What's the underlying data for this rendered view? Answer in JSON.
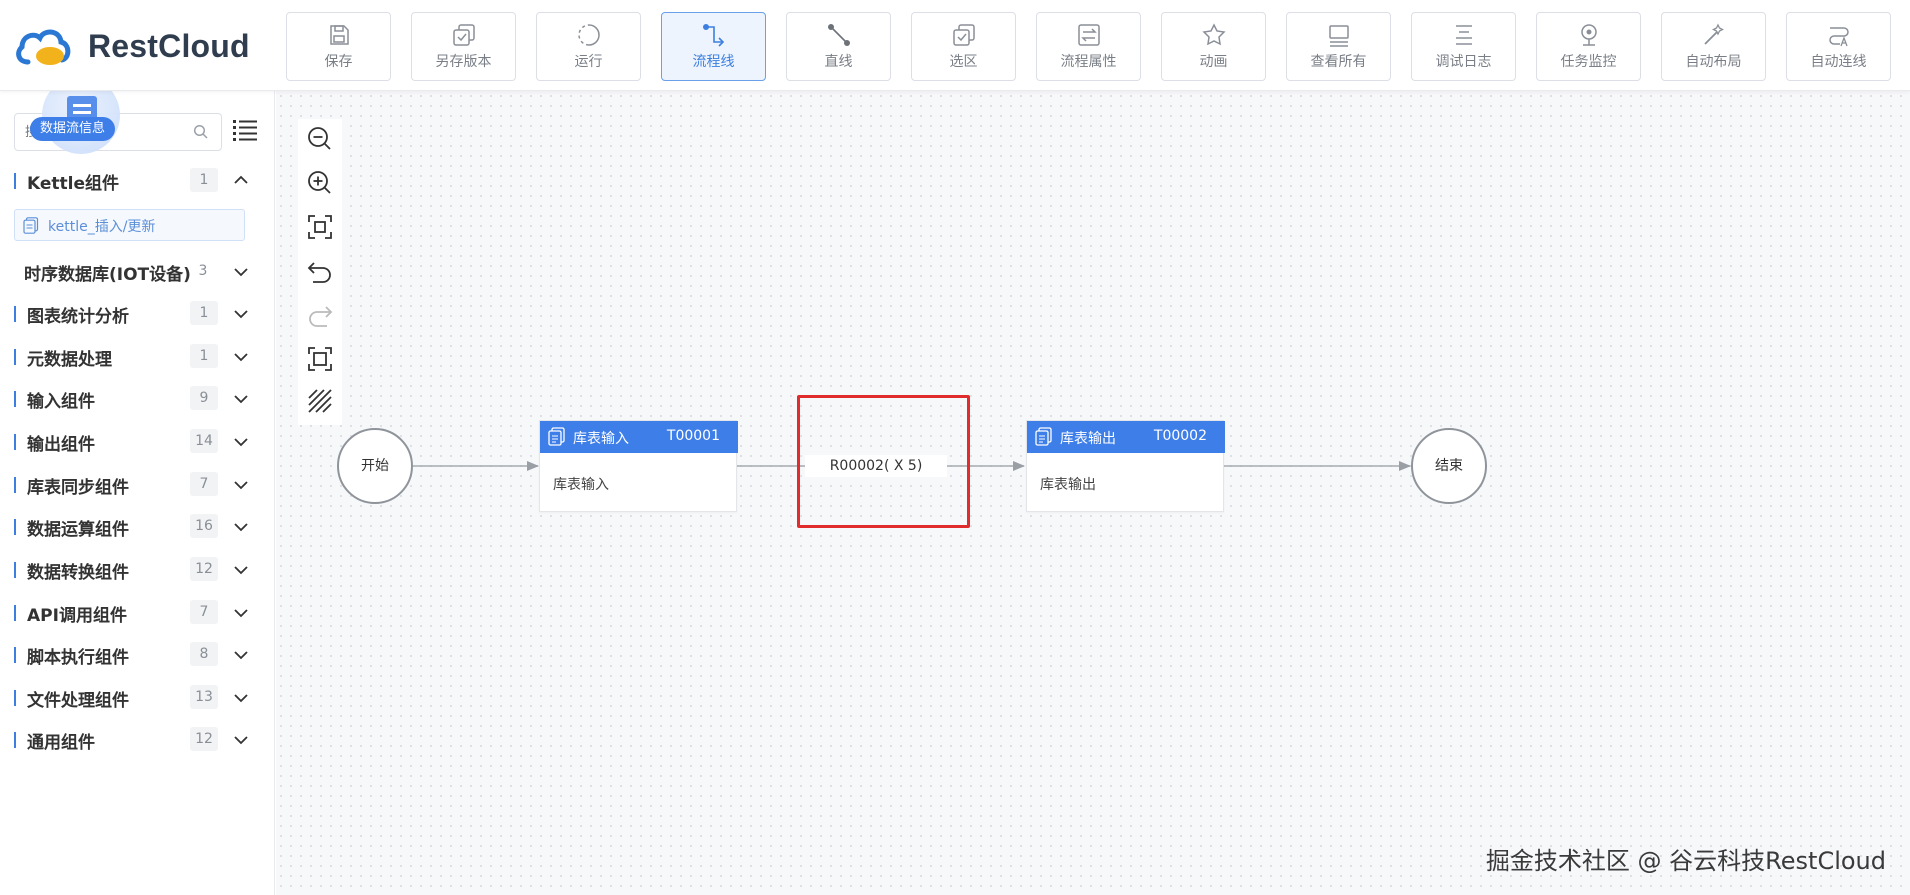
{
  "app": {
    "logo_text": "RestCloud"
  },
  "toolbar": [
    {
      "label": "保存",
      "icon": "save-icon"
    },
    {
      "label": "另存版本",
      "icon": "save-as-icon"
    },
    {
      "label": "运行",
      "icon": "run-icon"
    },
    {
      "label": "流程线",
      "icon": "flow-line-icon",
      "active": true
    },
    {
      "label": "直线",
      "icon": "straight-line-icon"
    },
    {
      "label": "选区",
      "icon": "select-area-icon"
    },
    {
      "label": "流程属性",
      "icon": "flow-props-icon"
    },
    {
      "label": "动画",
      "icon": "animation-icon"
    },
    {
      "label": "查看所有",
      "icon": "view-all-icon"
    },
    {
      "label": "调试日志",
      "icon": "debug-log-icon"
    },
    {
      "label": "任务监控",
      "icon": "task-monitor-icon"
    },
    {
      "label": "自动布局",
      "icon": "auto-layout-icon"
    },
    {
      "label": "自动连线",
      "icon": "auto-connect-icon"
    }
  ],
  "sidebar": {
    "search_placeholder": "搜",
    "float_label": "数据流信息",
    "categories": [
      {
        "name": "Kettle组件",
        "count": "1",
        "expanded": true,
        "accent": true
      },
      {
        "name": "时序数据库(IOT设备)",
        "count": "3",
        "accent": false
      },
      {
        "name": "图表统计分析",
        "count": "1",
        "accent": true
      },
      {
        "name": "元数据处理",
        "count": "1",
        "accent": true
      },
      {
        "name": "输入组件",
        "count": "9",
        "accent": true
      },
      {
        "name": "输出组件",
        "count": "14",
        "accent": true
      },
      {
        "name": "库表同步组件",
        "count": "7",
        "accent": true
      },
      {
        "name": "数据运算组件",
        "count": "16",
        "accent": true
      },
      {
        "name": "数据转换组件",
        "count": "12",
        "accent": true
      },
      {
        "name": "API调用组件",
        "count": "7",
        "accent": true
      },
      {
        "name": "脚本执行组件",
        "count": "8",
        "accent": true
      },
      {
        "name": "文件处理组件",
        "count": "13",
        "accent": true
      },
      {
        "name": "通用组件",
        "count": "12",
        "accent": true
      }
    ],
    "kettle_item": "kettle_插入/更新"
  },
  "canvas": {
    "start_label": "开始",
    "end_label": "结束",
    "node1": {
      "title": "库表输入",
      "id": "T00001",
      "body": "库表输入"
    },
    "node2": {
      "title": "库表输出",
      "id": "T00002",
      "body": "库表输出"
    },
    "edge_label": "R00002( X 5)"
  },
  "watermark": "掘金技术社区 @ 谷云科技RestCloud",
  "colors": {
    "accent": "#3e7ee8",
    "highlight": "#e02c2c"
  }
}
